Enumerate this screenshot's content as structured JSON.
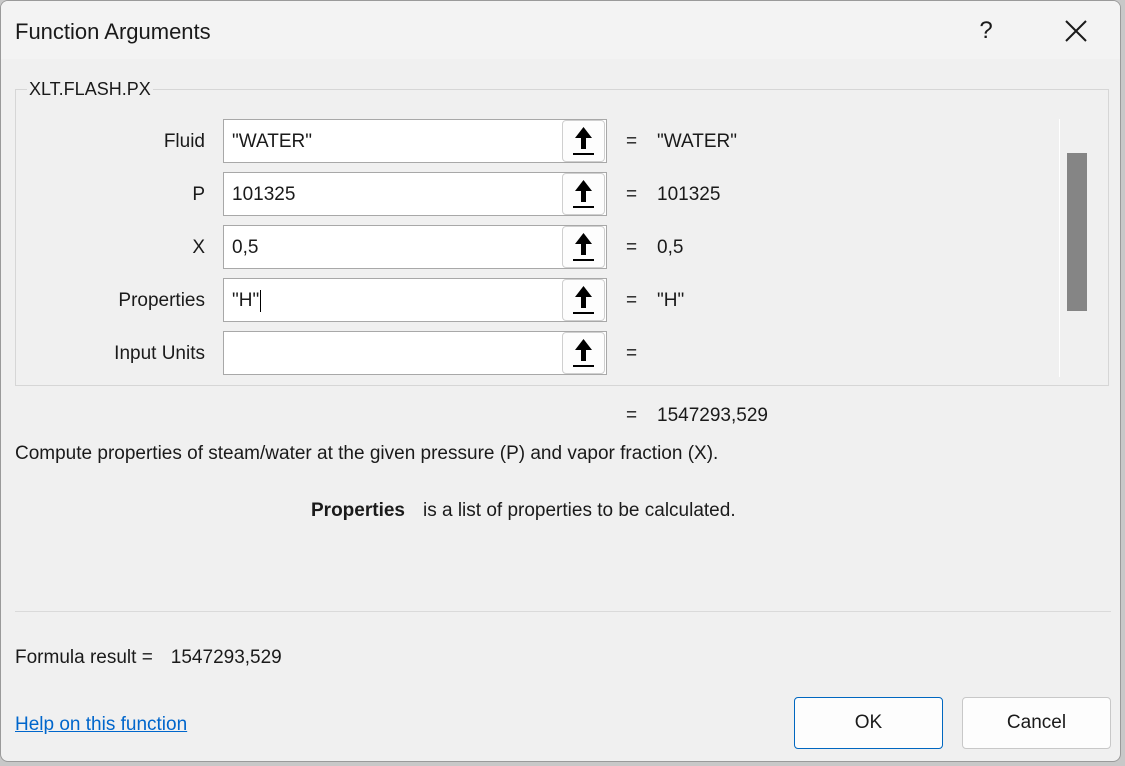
{
  "dialog": {
    "title": "Function Arguments",
    "help_label": "?",
    "function_name": "XLT.FLASH.PX"
  },
  "arguments": [
    {
      "label": "Fluid",
      "value": "\"WATER\"",
      "evaluated": "\"WATER\""
    },
    {
      "label": "P",
      "value": "101325",
      "evaluated": "101325"
    },
    {
      "label": "X",
      "value": "0,5",
      "evaluated": "0,5"
    },
    {
      "label": "Properties",
      "value": "\"H\"",
      "evaluated": "\"H\""
    },
    {
      "label": "Input Units",
      "value": "",
      "evaluated": ""
    }
  ],
  "equals": "=",
  "result_preview": "1547293,529",
  "description": "Compute properties of steam/water at the given pressure (P) and vapor fraction (X).",
  "argument_help": {
    "name": "Properties",
    "text": "is a list of properties to be calculated."
  },
  "formula_result": {
    "label": "Formula result =",
    "value": "1547293,529"
  },
  "help_link": "Help on this function",
  "buttons": {
    "ok": "OK",
    "cancel": "Cancel"
  },
  "colors": {
    "accent": "#0067c0",
    "link": "#0066cc"
  }
}
